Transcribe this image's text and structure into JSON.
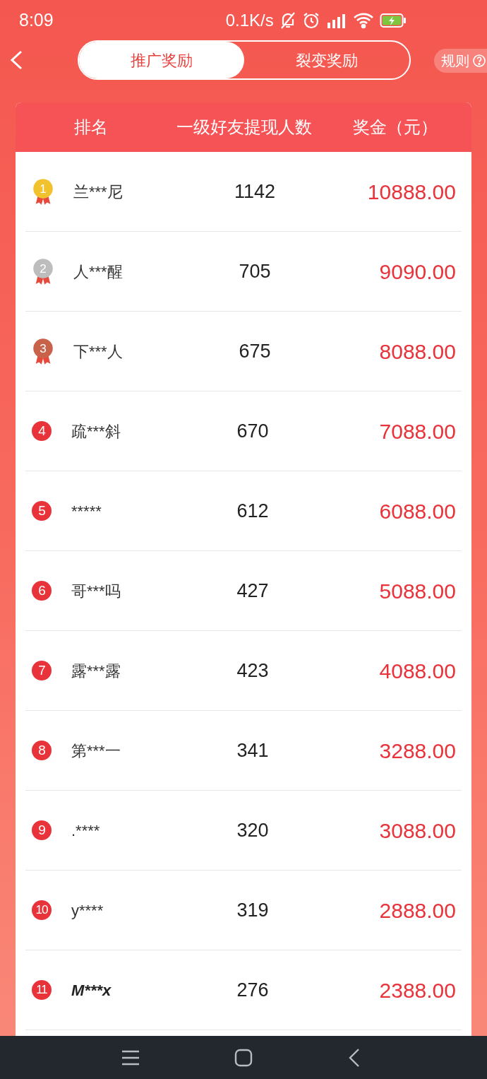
{
  "status_bar": {
    "time": "8:09",
    "net_speed": "0.1K/s"
  },
  "header": {
    "tabs": [
      {
        "label": "推广奖励",
        "selected": true
      },
      {
        "label": "裂变奖励",
        "selected": false
      }
    ],
    "rules_button": "规则"
  },
  "table": {
    "columns": [
      "排名",
      "一级好友提现人数",
      "奖金（元）"
    ],
    "rows": [
      {
        "rank": {
          "kind": "medal",
          "label": "1",
          "color": "#f2c12e"
        },
        "name": "兰***尼",
        "italic": false,
        "count": "1142",
        "prize": "10888.00"
      },
      {
        "rank": {
          "kind": "medal",
          "label": "2",
          "color": "#bdbdbd"
        },
        "name": "人***醒",
        "italic": false,
        "count": "705",
        "prize": "9090.00"
      },
      {
        "rank": {
          "kind": "medal",
          "label": "3",
          "color": "#c9624a"
        },
        "name": "下***人",
        "italic": false,
        "count": "675",
        "prize": "8088.00"
      },
      {
        "rank": {
          "kind": "badge",
          "label": "4"
        },
        "name": "疏***斜",
        "italic": false,
        "count": "670",
        "prize": "7088.00"
      },
      {
        "rank": {
          "kind": "badge",
          "label": "5"
        },
        "name": "*****",
        "italic": false,
        "count": "612",
        "prize": "6088.00"
      },
      {
        "rank": {
          "kind": "badge",
          "label": "6"
        },
        "name": "哥***吗",
        "italic": false,
        "count": "427",
        "prize": "5088.00"
      },
      {
        "rank": {
          "kind": "badge",
          "label": "7"
        },
        "name": "露***露",
        "italic": false,
        "count": "423",
        "prize": "4088.00"
      },
      {
        "rank": {
          "kind": "badge",
          "label": "8"
        },
        "name": "第***一",
        "italic": false,
        "count": "341",
        "prize": "3288.00"
      },
      {
        "rank": {
          "kind": "badge",
          "label": "9"
        },
        "name": ".****",
        "italic": false,
        "count": "320",
        "prize": "3088.00"
      },
      {
        "rank": {
          "kind": "badge",
          "label": "10"
        },
        "name": "y****",
        "italic": false,
        "count": "319",
        "prize": "2888.00"
      },
      {
        "rank": {
          "kind": "badge",
          "label": "11"
        },
        "name": "M***x",
        "italic": true,
        "count": "276",
        "prize": "2388.00"
      }
    ]
  }
}
